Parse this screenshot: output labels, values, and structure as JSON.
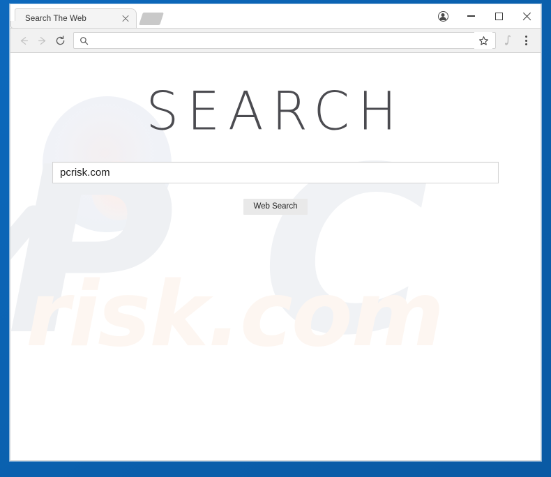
{
  "window": {
    "frame_color": "#0b63b5",
    "controls": {
      "profile_icon": "profile-icon",
      "minimize_icon": "minimize-icon",
      "maximize_icon": "maximize-icon",
      "close_icon": "close-icon"
    }
  },
  "tabstrip": {
    "tabs": [
      {
        "title": "Search The Web",
        "close_icon": "close-icon",
        "active": true
      }
    ],
    "new_tab_icon": "new-tab-icon"
  },
  "toolbar": {
    "back_icon": "back-arrow-icon",
    "forward_icon": "forward-arrow-icon",
    "reload_icon": "reload-icon",
    "address_value": "",
    "address_placeholder": "",
    "address_search_icon": "search-icon",
    "bookmark_icon": "star-icon",
    "extension_icon": "extension-icon",
    "menu_icon": "three-dot-menu-icon"
  },
  "page": {
    "brand": "SEARCH",
    "search_value": "pcrisk.com",
    "search_placeholder": "",
    "search_button": "Web Search",
    "watermark": {
      "letter_p": "P",
      "letter_c": "C",
      "suffix": "risk.com",
      "lens_icon": "magnifier-watermark-icon",
      "grey": "#eef0f3",
      "cream": "#fdf6f1"
    }
  }
}
